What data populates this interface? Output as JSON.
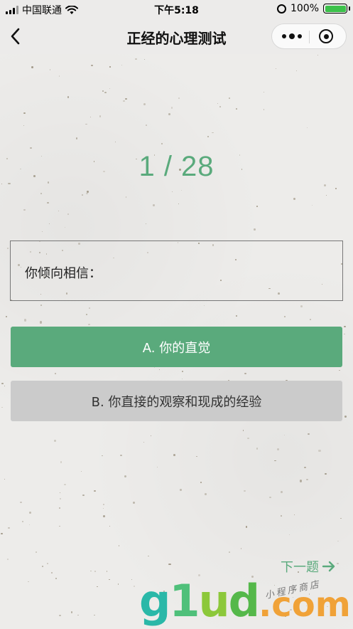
{
  "status_bar": {
    "carrier": "中国联通",
    "time": "下午5:18",
    "battery": "100%",
    "battery_level": 1.0
  },
  "nav": {
    "title": "正经的心理测试",
    "back_icon": "chevron-left-icon",
    "more_icon": "more-dots-icon",
    "close_icon": "target-close-icon"
  },
  "quiz": {
    "progress": "1 / 28",
    "question": "你倾向相信：",
    "options": [
      {
        "label": "A. 你的直觉",
        "selected": true
      },
      {
        "label": "B. 你直接的观察和现成的经验",
        "selected": false
      }
    ],
    "next_label": "下一题"
  },
  "watermark": {
    "logo": "g1ud",
    "suffix": ".com",
    "tagline": "小程序商店"
  },
  "colors": {
    "accent": "#5aaa7c",
    "option_unselected": "#cbcbcb",
    "background": "#edecea"
  }
}
